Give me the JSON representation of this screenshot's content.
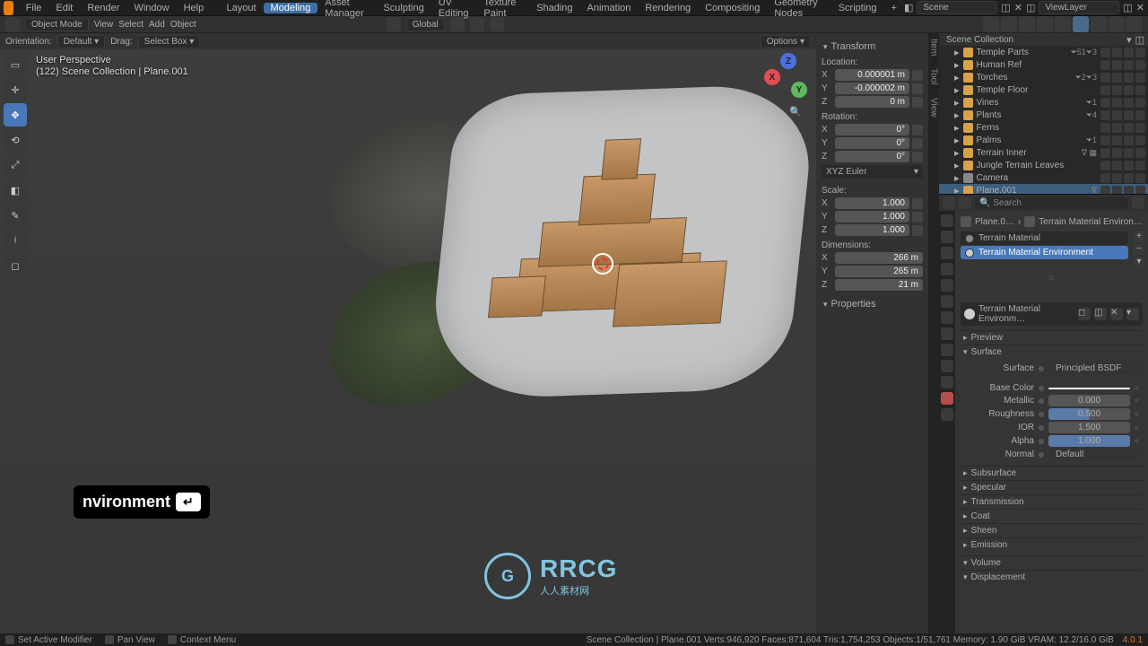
{
  "menubar": {
    "items": [
      "File",
      "Edit",
      "Render",
      "Window",
      "Help"
    ],
    "workspaces": [
      "Layout",
      "Modeling",
      "Asset Manager",
      "Sculpting",
      "UV Editing",
      "Texture Paint",
      "Shading",
      "Animation",
      "Rendering",
      "Compositing",
      "Geometry Nodes",
      "Scripting"
    ],
    "active_workspace": "Modeling",
    "scene_label": "Scene",
    "layer_label": "ViewLayer"
  },
  "toolbar": {
    "mode": "Object Mode",
    "menus": [
      "View",
      "Select",
      "Add",
      "Object"
    ],
    "orient_mode": "Global"
  },
  "orientbar": {
    "l1": "Orientation:",
    "v1": "Default",
    "l2": "Drag:",
    "v2": "Select Box",
    "options": "Options"
  },
  "viewport": {
    "persp": "User Perspective",
    "context": "(122) Scene Collection | Plane.001"
  },
  "keystroke": {
    "text": "nvironment",
    "key": "↵"
  },
  "watermark": {
    "big": "RRCG",
    "small": "人人素材网"
  },
  "transform": {
    "h": "Transform",
    "loc_label": "Location:",
    "loc": {
      "X": "0.000001 m",
      "Y": "-0.000002 m",
      "Z": "0 m"
    },
    "rot_label": "Rotation:",
    "rot": {
      "X": "0°",
      "Y": "0°",
      "Z": "0°"
    },
    "rot_mode": "XYZ Euler",
    "scale_label": "Scale:",
    "scale": {
      "X": "1.000",
      "Y": "1.000",
      "Z": "1.000"
    },
    "dim_label": "Dimensions:",
    "dim": {
      "X": "266 m",
      "Y": "265 m",
      "Z": "21 m"
    },
    "h2": "Properties"
  },
  "tabs": {
    "item": "Item",
    "tool": "Tool",
    "view": "View"
  },
  "outliner": {
    "header": "Scene Collection",
    "search_placeholder": "Search",
    "items": [
      {
        "name": "Temple Parts",
        "badge": "⏷51⏷3",
        "depth": 1
      },
      {
        "name": "Human Ref",
        "badge": "",
        "depth": 1
      },
      {
        "name": "Torches",
        "badge": "⏷2⏷3",
        "depth": 1
      },
      {
        "name": "Temple Floor",
        "badge": "",
        "depth": 1
      },
      {
        "name": "Vines",
        "badge": "⏷1",
        "depth": 1
      },
      {
        "name": "Plants",
        "badge": "⏷4",
        "depth": 1
      },
      {
        "name": "Ferns",
        "badge": "",
        "depth": 1
      },
      {
        "name": "Palms",
        "badge": "⏷1",
        "depth": 1
      },
      {
        "name": "Terrain Inner",
        "badge": "∇ ▦",
        "depth": 1
      },
      {
        "name": "Jungle Terrain Leaves",
        "badge": "",
        "depth": 1
      },
      {
        "name": "Camera",
        "badge": "",
        "depth": 1,
        "cam": true
      },
      {
        "name": "Plane.001",
        "badge": "∇",
        "depth": 1,
        "sel": true
      }
    ]
  },
  "properties": {
    "search_placeholder": "Search",
    "breadcrumb": {
      "obj": "Plane.0…",
      "mat": "Terrain Material Environ…"
    },
    "slots": [
      {
        "name": "Terrain Material",
        "active": false
      },
      {
        "name": "Terrain Material Environment",
        "active": true
      }
    ],
    "mat_name": "Terrain Material Environm…",
    "sections": {
      "preview": "Preview",
      "surface": "Surface",
      "subsurface": "Subsurface",
      "specular": "Specular",
      "transmission": "Transmission",
      "coat": "Coat",
      "sheen": "Sheen",
      "emission": "Emission",
      "volume": "Volume",
      "displacement": "Displacement"
    },
    "surface": {
      "shader_label": "Surface",
      "shader": "Principled BSDF",
      "base_color_label": "Base Color",
      "metallic_label": "Metallic",
      "metallic": "0.000",
      "roughness_label": "Roughness",
      "roughness": "0.500",
      "ior_label": "IOR",
      "ior": "1.500",
      "alpha_label": "Alpha",
      "alpha": "1.000",
      "normal_label": "Normal",
      "normal": "Default"
    }
  },
  "statusbar": {
    "items": [
      "Set Active Modifier",
      "Pan View",
      "Context Menu"
    ],
    "right": "Scene Collection | Plane.001  Verts:946,920  Faces:871,604  Tris:1,754,253  Objects:1/51,761  Memory: 1.90 GiB  VRAM: 12.2/16.0 GiB",
    "version": "4.0.1"
  }
}
